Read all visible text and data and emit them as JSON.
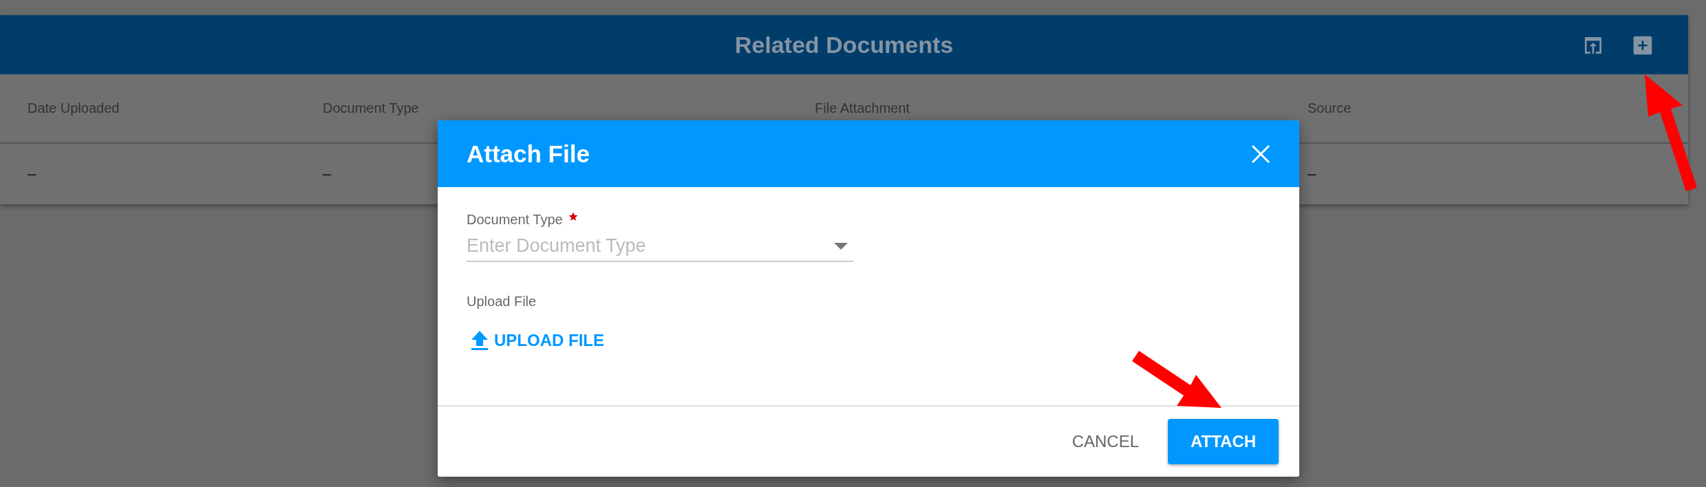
{
  "panel": {
    "title": "Related Documents",
    "columns": [
      "Date Uploaded",
      "Document Type",
      "File Attachment",
      "Source"
    ],
    "rows": [
      {
        "date_uploaded": "–",
        "document_type": "–",
        "source": "–"
      }
    ]
  },
  "dialog": {
    "title": "Attach File",
    "field": {
      "label": "Document Type",
      "required": true,
      "placeholder": "Enter Document Type"
    },
    "upload_label": "Upload File",
    "upload_button": "UPLOAD FILE",
    "buttons": [
      {
        "label": "CANCEL",
        "kind": "text"
      },
      {
        "label": "ATTACH",
        "kind": "primary"
      }
    ]
  },
  "annotation_arrows": [
    {
      "kind": "upleft"
    },
    {
      "kind": "downright"
    }
  ]
}
